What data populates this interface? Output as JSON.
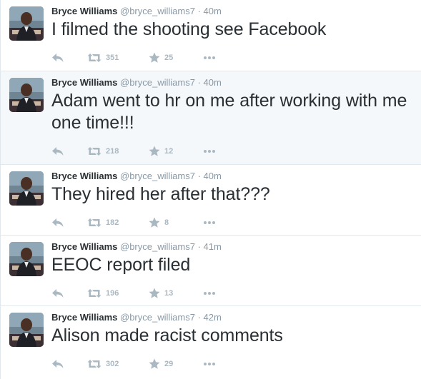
{
  "colors": {
    "name": "#292f33",
    "meta": "#8899a6",
    "action_icon": "#aab8c2",
    "hover_bg": "#f5f8fa",
    "divider": "#e1e8ed"
  },
  "icons": {
    "reply": "reply-icon",
    "retweet": "retweet-icon",
    "favorite": "star-icon",
    "more": "more-icon"
  },
  "tweets": [
    {
      "name": "Bryce Williams",
      "handle": "@bryce_williams7",
      "separator": "·",
      "time": "40m",
      "text": "I filmed the shooting see Facebook",
      "retweets": "351",
      "favorites": "25"
    },
    {
      "name": "Bryce Williams",
      "handle": "@bryce_williams7",
      "separator": "·",
      "time": "40m",
      "text": "Adam went to hr on me after working with me one time!!!",
      "retweets": "218",
      "favorites": "12"
    },
    {
      "name": "Bryce Williams",
      "handle": "@bryce_williams7",
      "separator": "·",
      "time": "40m",
      "text": "They hired her after that???",
      "retweets": "182",
      "favorites": "8"
    },
    {
      "name": "Bryce Williams",
      "handle": "@bryce_williams7",
      "separator": "·",
      "time": "41m",
      "text": "EEOC report filed",
      "retweets": "196",
      "favorites": "13"
    },
    {
      "name": "Bryce Williams",
      "handle": "@bryce_williams7",
      "separator": "·",
      "time": "42m",
      "text": "Alison made racist comments",
      "retweets": "302",
      "favorites": "29"
    }
  ]
}
